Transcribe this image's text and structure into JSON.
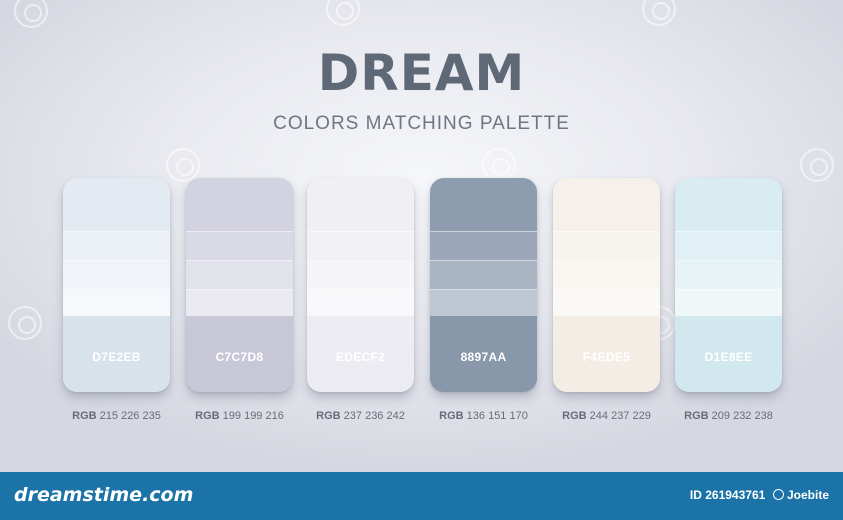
{
  "title": "DREAM",
  "subtitle": "COLORS MATCHING PALETTE",
  "palettes": [
    {
      "hex": "D7E2EB",
      "rgb_label": "RGB",
      "rgb_values": "215 226 235",
      "base": "#D7E2EB",
      "tints": [
        "#e3eaf1",
        "#eaf0f5",
        "#f0f4f8",
        "#f6f8fb",
        "#fbfcfd"
      ]
    },
    {
      "hex": "C7C7D8",
      "rgb_label": "RGB",
      "rgb_values": "199 199 216",
      "base": "#C7C7D8",
      "tints": [
        "#d2d2e0",
        "#dadae6",
        "#e2e2eb",
        "#eaeaf0",
        "#f4f4f7"
      ]
    },
    {
      "hex": "EDECF2",
      "rgb_label": "RGB",
      "rgb_values": "237 236 242",
      "base": "#EDECF2",
      "tints": [
        "#f0eff4",
        "#f2f2f6",
        "#f5f5f8",
        "#f8f8fa",
        "#fbfbfc"
      ]
    },
    {
      "hex": "8897AA",
      "rgb_label": "RGB",
      "rgb_values": "136 151 170",
      "base": "#8897AA",
      "tints": [
        "#8e9caf",
        "#9ba7b8",
        "#aab5c3",
        "#bfc7d2",
        "#dde2e8"
      ]
    },
    {
      "hex": "F4EDE5",
      "rgb_label": "RGB",
      "rgb_values": "244 237 229",
      "base": "#F4EDE5",
      "tints": [
        "#f6f0ea",
        "#f7f3ee",
        "#f9f6f2",
        "#fbf9f6",
        "#fdfcfa"
      ]
    },
    {
      "hex": "D1E8EE",
      "rgb_label": "RGB",
      "rgb_values": "209 232 238",
      "base": "#D1E8EE",
      "tints": [
        "#d8ecf1",
        "#e0f0f4",
        "#e7f3f6",
        "#eff7f9",
        "#f8fbfc"
      ]
    }
  ],
  "footer": {
    "brand": "dreamstime.com",
    "id_text": "ID 261943761",
    "author": "Joebite"
  },
  "icons": {
    "copyright": "copyright-icon",
    "watermark": "dreamstime-swirl-icon"
  },
  "colors": {
    "footer_bg": "#1b73a8",
    "title": "#5f6876"
  }
}
